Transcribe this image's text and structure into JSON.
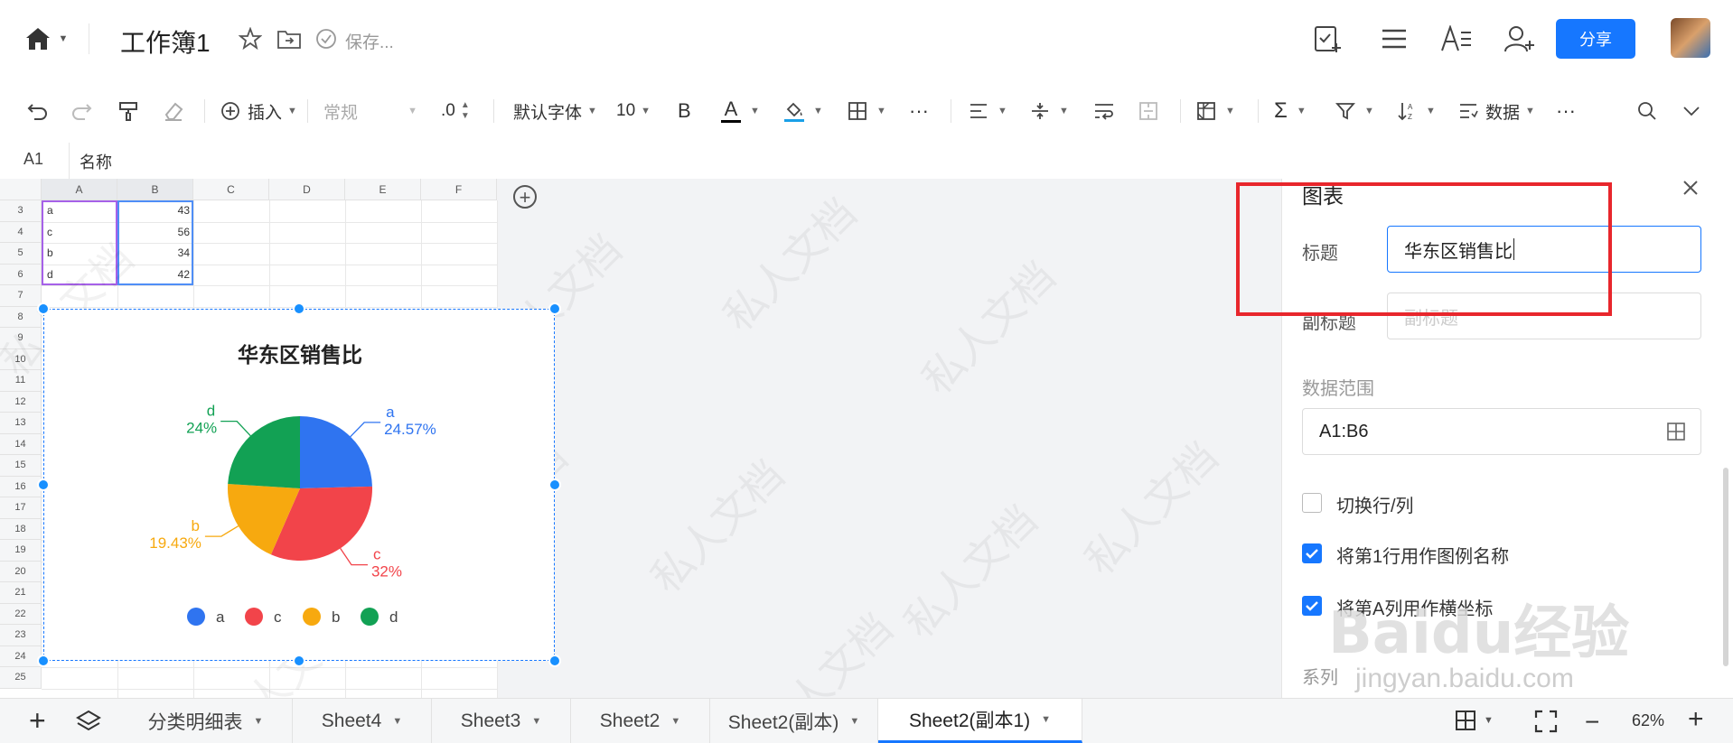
{
  "app": {
    "doc_title": "工作簿1",
    "save_status": "保存...",
    "share_label": "分享"
  },
  "toolbar": {
    "insert_label": "插入",
    "format_value": "常规",
    "decimal_label": ".0",
    "font_family_value": "默认字体",
    "font_size_value": "10",
    "bold_label": "B",
    "font_color_label": "A",
    "font_color": "#000000",
    "fill_color": "#1aa0e8",
    "data_label": "数据"
  },
  "formula_bar": {
    "cell_ref": "A1",
    "content": "名称"
  },
  "grid": {
    "columns": [
      "A",
      "B",
      "C",
      "D",
      "E",
      "F"
    ],
    "rows": [
      "3",
      "4",
      "5",
      "6",
      "7",
      "8",
      "9",
      "10",
      "11",
      "12",
      "13",
      "14",
      "15",
      "16",
      "17",
      "18",
      "19",
      "20",
      "21",
      "22",
      "23",
      "24",
      "25"
    ],
    "cells": [
      {
        "row": "3",
        "a": "a",
        "b": "43"
      },
      {
        "row": "4",
        "a": "c",
        "b": "56"
      },
      {
        "row": "5",
        "a": "b",
        "b": "34"
      },
      {
        "row": "6",
        "a": "d",
        "b": "42"
      }
    ]
  },
  "chart_data": {
    "type": "pie",
    "title": "华东区销售比",
    "slices": [
      {
        "name": "a",
        "value": 43,
        "label": "24.57%",
        "color": "#2f74f0"
      },
      {
        "name": "c",
        "value": 56,
        "label": "32%",
        "color": "#f2444a"
      },
      {
        "name": "b",
        "value": 34,
        "label": "19.43%",
        "color": "#f7a90f"
      },
      {
        "name": "d",
        "value": 42,
        "label": "24%",
        "color": "#12a154"
      }
    ],
    "legend": [
      "a",
      "c",
      "b",
      "d"
    ],
    "legend_position": "bottom"
  },
  "panel": {
    "title": "图表",
    "title_label": "标题",
    "title_value": "华东区销售比",
    "subtitle_label": "副标题",
    "subtitle_placeholder": "副标题",
    "range_label": "数据范围",
    "range_value": "A1:B6",
    "switch_label": "切换行/列",
    "switch_checked": false,
    "legend_label": "将第1行用作图例名称",
    "legend_checked": true,
    "axis_label": "将第A列用作横坐标",
    "axis_checked": true,
    "series_label": "系列"
  },
  "tabs": [
    {
      "label": "分类明细表",
      "active": false
    },
    {
      "label": "Sheet4",
      "active": false
    },
    {
      "label": "Sheet3",
      "active": false
    },
    {
      "label": "Sheet2",
      "active": false
    },
    {
      "label": "Sheet2(副本)",
      "active": false
    },
    {
      "label": "Sheet2(副本1)",
      "active": true
    }
  ],
  "zoom": "62%",
  "watermark": {
    "text": "私人文档"
  },
  "baidu": {
    "logo": "Baidu经验",
    "url": "jingyan.baidu.com"
  }
}
